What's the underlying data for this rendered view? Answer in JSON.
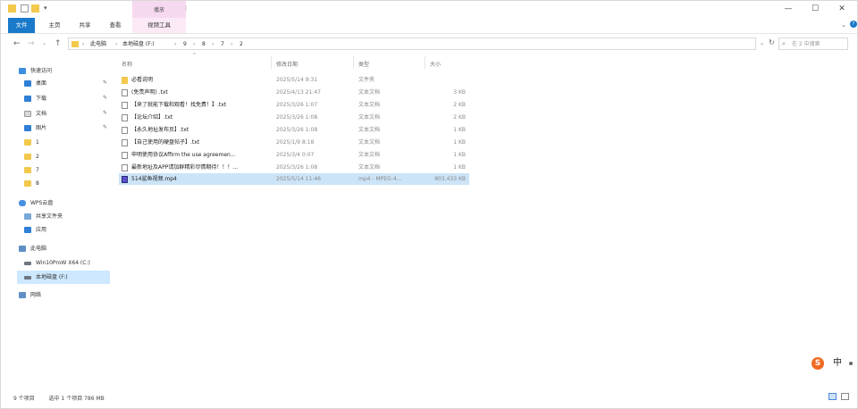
{
  "titlebar": {
    "context_tab_label": "播放",
    "minimize": "—",
    "maximize": "☐",
    "close": "✕"
  },
  "ribbon": {
    "tabs": [
      "文件",
      "主页",
      "共享",
      "查看",
      "视频工具"
    ]
  },
  "address": {
    "crumbs": [
      "此电脑",
      "本地磁盘 (F:)",
      "9",
      "8",
      "7",
      "2"
    ],
    "search_placeholder": "在 2 中搜索"
  },
  "sidebar": {
    "quick_access": "快速访问",
    "items": [
      {
        "label": "桌面",
        "icon": "desktop-icon",
        "pinned": true
      },
      {
        "label": "下载",
        "icon": "download-icon",
        "pinned": true
      },
      {
        "label": "文档",
        "icon": "document-icon",
        "pinned": true
      },
      {
        "label": "图片",
        "icon": "picture-icon",
        "pinned": true
      },
      {
        "label": "1",
        "icon": "folder-icon"
      },
      {
        "label": "2",
        "icon": "folder-icon"
      },
      {
        "label": "7",
        "icon": "folder-icon"
      },
      {
        "label": "8",
        "icon": "folder-icon"
      }
    ],
    "wps_label": "WPS云盘",
    "wps_items": [
      {
        "label": "共享文件夹",
        "icon": "shared-folder-icon"
      },
      {
        "label": "应用",
        "icon": "apps-icon"
      }
    ],
    "this_pc": "此电脑",
    "drives": [
      {
        "label": "Win10ProW X64 (C:)",
        "icon": "drive-icon"
      },
      {
        "label": "本地磁盘 (F:)",
        "icon": "drive-icon"
      }
    ],
    "network": "网络"
  },
  "columns": {
    "name": "名称",
    "date": "修改日期",
    "type": "类型",
    "size": "大小"
  },
  "files": [
    {
      "name": "必看说明",
      "date": "2025/5/14 9:31",
      "type": "文件夹",
      "size": "",
      "icon": "folder"
    },
    {
      "name": "(免责声明) .txt",
      "date": "2025/4/13 21:47",
      "type": "文本文档",
      "size": "3 KB",
      "icon": "text"
    },
    {
      "name": "【来了就能下载和观看！找免费！】.txt",
      "date": "2025/3/26 1:07",
      "type": "文本文档",
      "size": "2 KB",
      "icon": "text"
    },
    {
      "name": "【论坛介绍】.txt",
      "date": "2025/3/26 1:08",
      "type": "文本文档",
      "size": "2 KB",
      "icon": "text"
    },
    {
      "name": "【永久地址发布页】.txt",
      "date": "2025/3/26 1:08",
      "type": "文本文档",
      "size": "1 KB",
      "icon": "text"
    },
    {
      "name": "【自己使用的硬盘帖子】.txt",
      "date": "2025/1/9 8:18",
      "type": "文本文档",
      "size": "1 KB",
      "icon": "text"
    },
    {
      "name": "申明使用协议Affirm the use agreemen...",
      "date": "2025/3/4 0:07",
      "type": "文本文档",
      "size": "1 KB",
      "icon": "text"
    },
    {
      "name": "最新地址及APP请加群精彩尽情期待！！！...",
      "date": "2025/3/26 1:08",
      "type": "文本文档",
      "size": "1 KB",
      "icon": "text"
    },
    {
      "name": "514鲨鱼视频.mp4",
      "date": "2025/5/14 11:46",
      "type": "mp4 - MPEG-4...",
      "size": "803,433 KB",
      "icon": "video",
      "selected": true
    }
  ],
  "status": {
    "count": "9 个项目",
    "selection": "选中 1 个项目  786 MB"
  },
  "ime": {
    "logo": "S",
    "lang": "中"
  }
}
